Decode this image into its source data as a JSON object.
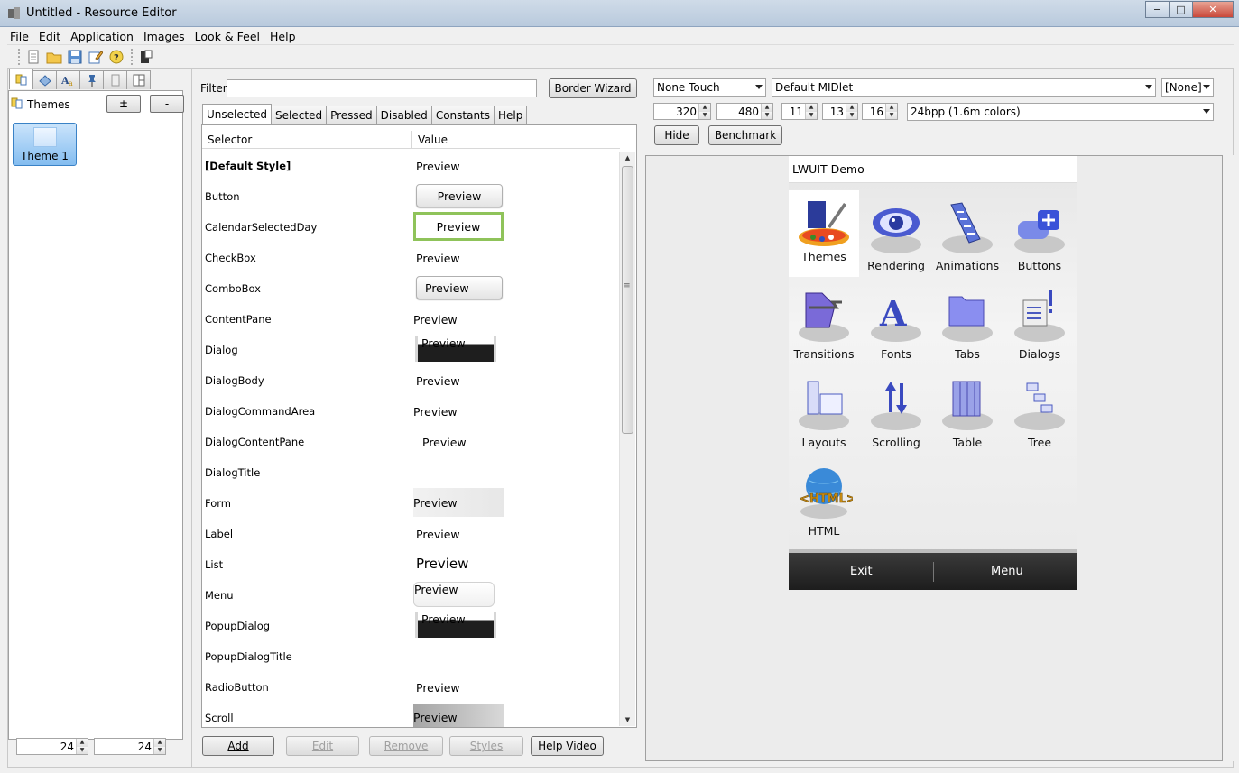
{
  "window": {
    "title": "Untitled - Resource Editor",
    "minimize": "−",
    "maximize": "□",
    "close": "✕"
  },
  "menubar": [
    "File",
    "Edit",
    "Application",
    "Images",
    "Look & Feel",
    "Help"
  ],
  "toolbar": [
    "new-icon",
    "open-icon",
    "save-icon",
    "edit-icon",
    "help-icon",
    "exit-icon"
  ],
  "left": {
    "themes_label": "Themes",
    "add_label": "±",
    "remove_label": "-",
    "theme_item": "Theme 1",
    "width_value": "24",
    "height_value": "24"
  },
  "middle": {
    "filter_label": "Filter",
    "filter_value": "",
    "border_wizard": "Border Wizard",
    "tabs": [
      "Unselected",
      "Selected",
      "Pressed",
      "Disabled",
      "Constants",
      "Help"
    ],
    "col_selector": "Selector",
    "col_value": "Value",
    "rows": [
      {
        "selector": "[Default Style]",
        "preview": "Preview"
      },
      {
        "selector": "Button",
        "preview": "Preview"
      },
      {
        "selector": "CalendarSelectedDay",
        "preview": "Preview"
      },
      {
        "selector": "CheckBox",
        "preview": "Preview"
      },
      {
        "selector": "ComboBox",
        "preview": "Preview"
      },
      {
        "selector": "ContentPane",
        "preview": "Preview"
      },
      {
        "selector": "Dialog",
        "preview": "Preview"
      },
      {
        "selector": "DialogBody",
        "preview": "Preview"
      },
      {
        "selector": "DialogCommandArea",
        "preview": "Preview"
      },
      {
        "selector": "DialogContentPane",
        "preview": "Preview"
      },
      {
        "selector": "DialogTitle",
        "preview": ""
      },
      {
        "selector": "Form",
        "preview": "Preview"
      },
      {
        "selector": "Label",
        "preview": "Preview"
      },
      {
        "selector": "List",
        "preview": "Preview"
      },
      {
        "selector": "Menu",
        "preview": "Preview"
      },
      {
        "selector": "PopupDialog",
        "preview": "Preview"
      },
      {
        "selector": "PopupDialogTitle",
        "preview": ""
      },
      {
        "selector": "RadioButton",
        "preview": "Preview"
      },
      {
        "selector": "Scroll",
        "preview": "Preview"
      }
    ],
    "buttons": {
      "add": "Add",
      "edit": "Edit",
      "remove": "Remove",
      "styles": "Styles",
      "help_video": "Help Video"
    }
  },
  "right": {
    "device": "None Touch",
    "midlet": "Default MIDlet",
    "none": "[None]",
    "width": "320",
    "height": "480",
    "font_small": "11",
    "font_medium": "13",
    "font_large": "16",
    "color_depth": "24bpp (1.6m colors)",
    "hide": "Hide",
    "benchmark": "Benchmark"
  },
  "phone": {
    "title": "LWUIT Demo",
    "apps": [
      "Themes",
      "Rendering",
      "Animations",
      "Buttons",
      "Transitions",
      "Fonts",
      "Tabs",
      "Dialogs",
      "Layouts",
      "Scrolling",
      "Table",
      "Tree",
      "HTML"
    ],
    "html_badge": "<HTML>",
    "exit": "Exit",
    "menu": "Menu"
  }
}
